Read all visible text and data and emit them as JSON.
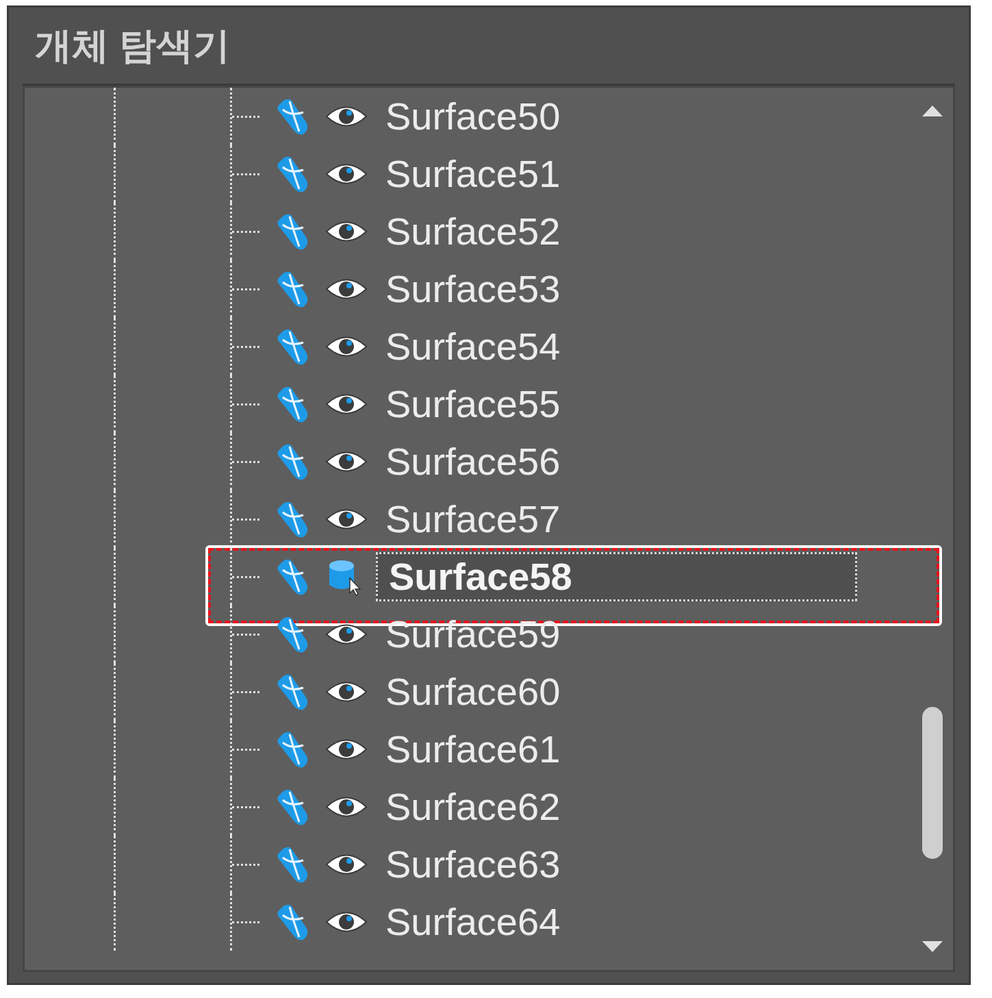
{
  "panel": {
    "title": "개체 탐색기"
  },
  "tree": {
    "items": [
      {
        "label": "Surface50",
        "selected": false,
        "highlighted": false
      },
      {
        "label": "Surface51",
        "selected": false,
        "highlighted": false
      },
      {
        "label": "Surface52",
        "selected": false,
        "highlighted": false
      },
      {
        "label": "Surface53",
        "selected": false,
        "highlighted": false
      },
      {
        "label": "Surface54",
        "selected": false,
        "highlighted": false
      },
      {
        "label": "Surface55",
        "selected": false,
        "highlighted": false
      },
      {
        "label": "Surface56",
        "selected": false,
        "highlighted": false
      },
      {
        "label": "Surface57",
        "selected": false,
        "highlighted": false
      },
      {
        "label": "Surface58",
        "selected": true,
        "highlighted": true
      },
      {
        "label": "Surface59",
        "selected": false,
        "highlighted": false
      },
      {
        "label": "Surface60",
        "selected": false,
        "highlighted": false
      },
      {
        "label": "Surface61",
        "selected": false,
        "highlighted": false
      },
      {
        "label": "Surface62",
        "selected": false,
        "highlighted": false
      },
      {
        "label": "Surface63",
        "selected": false,
        "highlighted": false
      },
      {
        "label": "Surface64",
        "selected": false,
        "highlighted": false
      }
    ]
  }
}
